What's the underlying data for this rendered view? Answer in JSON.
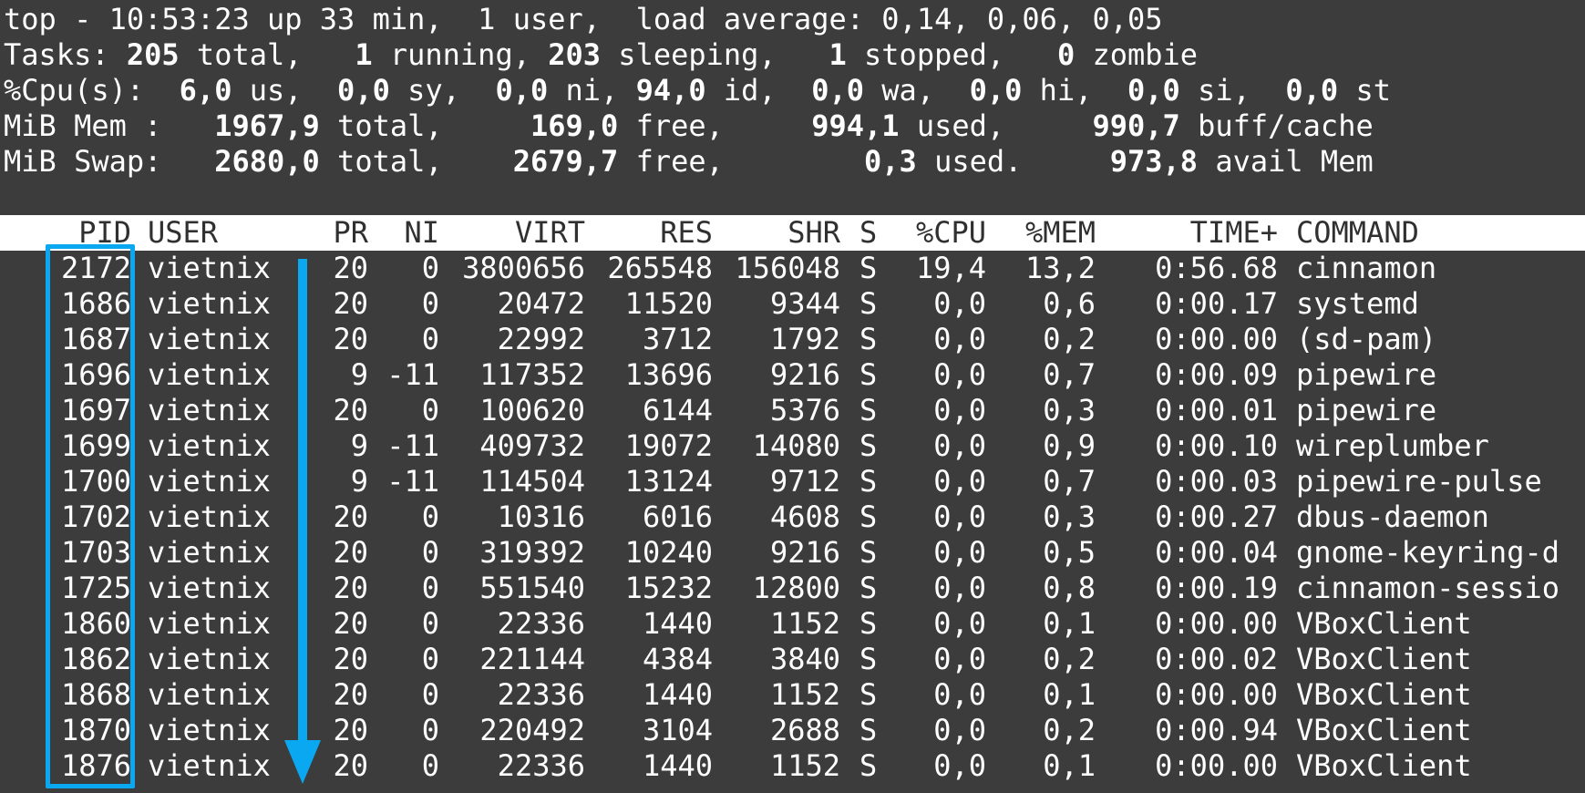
{
  "summary": {
    "line1": "top - 10:53:23 up 33 min,  1 user,  load average: 0,14, 0,06, 0,05",
    "tasks": [
      "Tasks: ",
      "205",
      " total,   ",
      "1",
      " running, ",
      "203",
      " sleeping,   ",
      "1",
      " stopped,   ",
      "0",
      " zombie"
    ],
    "cpu": [
      "%Cpu(s):  ",
      "6,0",
      " us,  ",
      "0,0",
      " sy,  ",
      "0,0",
      " ni, ",
      "94,0",
      " id,  ",
      "0,0",
      " wa,  ",
      "0,0",
      " hi,  ",
      "0,0",
      " si,  ",
      "0,0",
      " st"
    ],
    "mem": [
      "MiB Mem :   ",
      "1967,9",
      " total,     ",
      "169,0",
      " free,     ",
      "994,1",
      " used,     ",
      "990,7",
      " buff/cache"
    ],
    "swap": [
      "MiB Swap:   ",
      "2680,0",
      " total,    ",
      "2679,7",
      " free,        ",
      "0,3",
      " used.     ",
      "973,8",
      " avail Mem"
    ]
  },
  "columns": {
    "pid": "PID",
    "user": "USER",
    "pr": "PR",
    "ni": "NI",
    "virt": "VIRT",
    "res": "RES",
    "shr": "SHR",
    "s": "S",
    "cpu": "%CPU",
    "mem": "%MEM",
    "time": "TIME+",
    "command": "COMMAND"
  },
  "processes": [
    [
      "2172",
      "vietnix",
      "20",
      "0",
      "3800656",
      "265548",
      "156048",
      "S",
      "19,4",
      "13,2",
      "0:56.68",
      "cinnamon"
    ],
    [
      "1686",
      "vietnix",
      "20",
      "0",
      "20472",
      "11520",
      "9344",
      "S",
      "0,0",
      "0,6",
      "0:00.17",
      "systemd"
    ],
    [
      "1687",
      "vietnix",
      "20",
      "0",
      "22992",
      "3712",
      "1792",
      "S",
      "0,0",
      "0,2",
      "0:00.00",
      "(sd-pam)"
    ],
    [
      "1696",
      "vietnix",
      "9",
      "-11",
      "117352",
      "13696",
      "9216",
      "S",
      "0,0",
      "0,7",
      "0:00.09",
      "pipewire"
    ],
    [
      "1697",
      "vietnix",
      "20",
      "0",
      "100620",
      "6144",
      "5376",
      "S",
      "0,0",
      "0,3",
      "0:00.01",
      "pipewire"
    ],
    [
      "1699",
      "vietnix",
      "9",
      "-11",
      "409732",
      "19072",
      "14080",
      "S",
      "0,0",
      "0,9",
      "0:00.10",
      "wireplumber"
    ],
    [
      "1700",
      "vietnix",
      "9",
      "-11",
      "114504",
      "13124",
      "9712",
      "S",
      "0,0",
      "0,7",
      "0:00.03",
      "pipewire-pulse"
    ],
    [
      "1702",
      "vietnix",
      "20",
      "0",
      "10316",
      "6016",
      "4608",
      "S",
      "0,0",
      "0,3",
      "0:00.27",
      "dbus-daemon"
    ],
    [
      "1703",
      "vietnix",
      "20",
      "0",
      "319392",
      "10240",
      "9216",
      "S",
      "0,0",
      "0,5",
      "0:00.04",
      "gnome-keyring-d"
    ],
    [
      "1725",
      "vietnix",
      "20",
      "0",
      "551540",
      "15232",
      "12800",
      "S",
      "0,0",
      "0,8",
      "0:00.19",
      "cinnamon-sessio"
    ],
    [
      "1860",
      "vietnix",
      "20",
      "0",
      "22336",
      "1440",
      "1152",
      "S",
      "0,0",
      "0,1",
      "0:00.00",
      "VBoxClient"
    ],
    [
      "1862",
      "vietnix",
      "20",
      "0",
      "221144",
      "4384",
      "3840",
      "S",
      "0,0",
      "0,2",
      "0:00.02",
      "VBoxClient"
    ],
    [
      "1868",
      "vietnix",
      "20",
      "0",
      "22336",
      "1440",
      "1152",
      "S",
      "0,0",
      "0,1",
      "0:00.00",
      "VBoxClient"
    ],
    [
      "1870",
      "vietnix",
      "20",
      "0",
      "220492",
      "3104",
      "2688",
      "S",
      "0,0",
      "0,2",
      "0:00.94",
      "VBoxClient"
    ],
    [
      "1876",
      "vietnix",
      "20",
      "0",
      "22336",
      "1440",
      "1152",
      "S",
      "0,0",
      "0,1",
      "0:00.00",
      "VBoxClient"
    ]
  ],
  "colors": {
    "background": "#3c3c3c",
    "text": "#ffffff",
    "header_bg": "#ffffff",
    "header_text": "#303030",
    "annotation": "#0aa8f0"
  },
  "annotations": {
    "box_icon": "highlight-box",
    "arrow_icon": "down-arrow-icon"
  }
}
